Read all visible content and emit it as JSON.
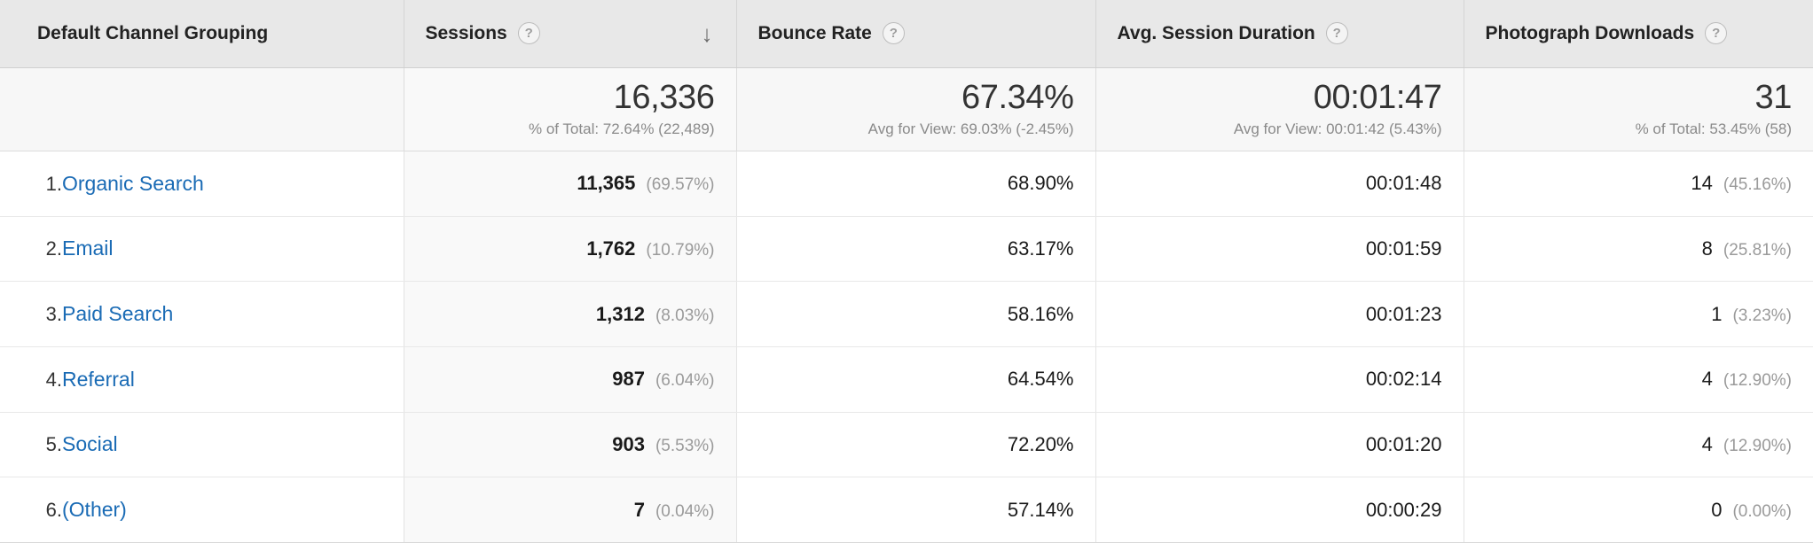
{
  "table": {
    "columns": [
      {
        "id": "dimension",
        "label": "Default Channel Grouping",
        "has_help": false,
        "sorted": false
      },
      {
        "id": "sessions",
        "label": "Sessions",
        "has_help": true,
        "sorted": true,
        "sort_direction": "descending",
        "sort_icon": "arrow-down-icon"
      },
      {
        "id": "bounce_rate",
        "label": "Bounce Rate",
        "has_help": true,
        "sorted": false
      },
      {
        "id": "avg_session_duration",
        "label": "Avg. Session Duration",
        "has_help": true,
        "sorted": false
      },
      {
        "id": "photograph_downloads",
        "label": "Photograph Downloads",
        "has_help": true,
        "sorted": false
      }
    ],
    "help_icon_glyph": "?",
    "sort_arrow_glyph": "↓",
    "summary": {
      "dimension": "",
      "sessions": {
        "value": "16,336",
        "sub": "% of Total: 72.64% (22,489)"
      },
      "bounce_rate": {
        "value": "67.34%",
        "sub": "Avg for View: 69.03% (-2.45%)"
      },
      "avg_session_duration": {
        "value": "00:01:47",
        "sub": "Avg for View: 00:01:42 (5.43%)"
      },
      "photograph_downloads": {
        "value": "31",
        "sub": "% of Total: 53.45% (58)"
      }
    },
    "rows": [
      {
        "index": "1.",
        "dimension": "Organic Search",
        "sessions": "11,365",
        "sessions_pct": "(69.57%)",
        "bounce_rate": "68.90%",
        "avg_session_duration": "00:01:48",
        "photograph_downloads": "14",
        "photograph_downloads_pct": "(45.16%)"
      },
      {
        "index": "2.",
        "dimension": "Email",
        "sessions": "1,762",
        "sessions_pct": "(10.79%)",
        "bounce_rate": "63.17%",
        "avg_session_duration": "00:01:59",
        "photograph_downloads": "8",
        "photograph_downloads_pct": "(25.81%)"
      },
      {
        "index": "3.",
        "dimension": "Paid Search",
        "sessions": "1,312",
        "sessions_pct": "(8.03%)",
        "bounce_rate": "58.16%",
        "avg_session_duration": "00:01:23",
        "photograph_downloads": "1",
        "photograph_downloads_pct": "(3.23%)"
      },
      {
        "index": "4.",
        "dimension": "Referral",
        "sessions": "987",
        "sessions_pct": "(6.04%)",
        "bounce_rate": "64.54%",
        "avg_session_duration": "00:02:14",
        "photograph_downloads": "4",
        "photograph_downloads_pct": "(12.90%)"
      },
      {
        "index": "5.",
        "dimension": "Social",
        "sessions": "903",
        "sessions_pct": "(5.53%)",
        "bounce_rate": "72.20%",
        "avg_session_duration": "00:01:20",
        "photograph_downloads": "4",
        "photograph_downloads_pct": "(12.90%)"
      },
      {
        "index": "6.",
        "dimension": "(Other)",
        "sessions": "7",
        "sessions_pct": "(0.04%)",
        "bounce_rate": "57.14%",
        "avg_session_duration": "00:00:29",
        "photograph_downloads": "0",
        "photograph_downloads_pct": "(0.00%)"
      }
    ]
  },
  "colors": {
    "link": "#1a6bb5",
    "header_bg": "#e8e8e8",
    "summary_bg": "#f7f7f7",
    "sessions_column_bg": "#f9f9f9"
  }
}
